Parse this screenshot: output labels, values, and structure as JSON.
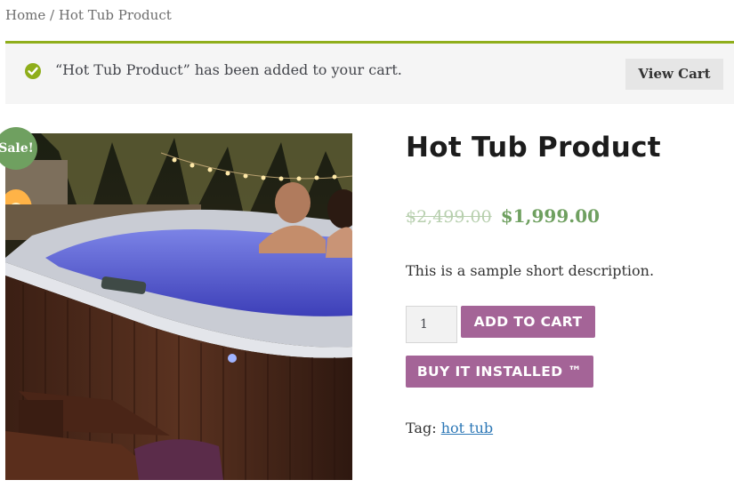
{
  "breadcrumb": {
    "home": "Home",
    "separator": " / ",
    "current": "Hot Tub Product"
  },
  "notice": {
    "message": "“Hot Tub Product” has been added to your cart.",
    "view_cart_label": "View Cart",
    "accent_color": "#8fae1b"
  },
  "product": {
    "sale_badge": "Sale!",
    "title": "Hot Tub Product",
    "price_old": "$2,499.00",
    "price_new": "$1,999.00",
    "short_description": "This is a sample short description.",
    "quantity": "1",
    "add_to_cart_label": "ADD TO CART",
    "buy_installed_label": "BUY IT INSTALLED ™",
    "tag_label": "Tag: ",
    "tag_value": "hot tub",
    "button_color": "#a46497",
    "sale_color": "#6fa060"
  }
}
